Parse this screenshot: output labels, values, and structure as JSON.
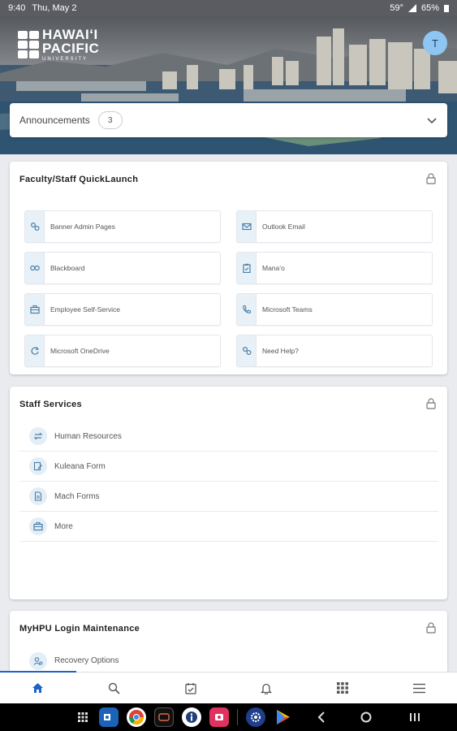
{
  "status_bar": {
    "time": "9:40",
    "date": "Thu, May 2",
    "temp": "59°",
    "battery": "65%"
  },
  "header": {
    "logo_line1": "HAWAIʻI",
    "logo_line2": "PACIFIC",
    "logo_line3": "UNIVERSITY",
    "avatar_initial": "T"
  },
  "announcements": {
    "label": "Announcements",
    "count": "3"
  },
  "quicklaunch": {
    "title": "Faculty/Staff QuickLaunch",
    "items": [
      {
        "label": "Banner Admin Pages",
        "icon": "gears-icon"
      },
      {
        "label": "Outlook Email",
        "icon": "mail-icon"
      },
      {
        "label": "Blackboard",
        "icon": "link-icon"
      },
      {
        "label": "Manaʻo",
        "icon": "clipboard-icon"
      },
      {
        "label": "Employee Self-Service",
        "icon": "briefcase-icon"
      },
      {
        "label": "Microsoft Teams",
        "icon": "phone-icon"
      },
      {
        "label": "Microsoft OneDrive",
        "icon": "refresh-icon"
      },
      {
        "label": "Need Help?",
        "icon": "gears-icon"
      }
    ]
  },
  "staff_services": {
    "title": "Staff Services",
    "items": [
      {
        "label": "Human Resources",
        "icon": "exchange-icon"
      },
      {
        "label": "Kuleana Form",
        "icon": "edit-document-icon"
      },
      {
        "label": "Mach Forms",
        "icon": "document-icon"
      },
      {
        "label": "More",
        "icon": "briefcase-icon"
      }
    ]
  },
  "login_maintenance": {
    "title": "MyHPU Login Maintenance",
    "items": [
      {
        "label": "Recovery Options",
        "icon": "user-gear-icon"
      }
    ]
  },
  "colors": {
    "accent": "#1e63c8",
    "icon_bg": "#e8f1f7",
    "icon_color": "#4a7fa8"
  }
}
